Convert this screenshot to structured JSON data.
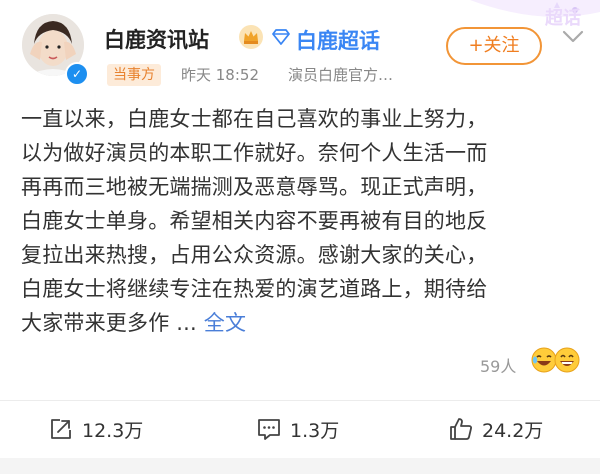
{
  "header": {
    "username": "白鹿资讯站",
    "topic_link": "白鹿超话",
    "follow_label": "+关注",
    "badge": "当事方",
    "time": "昨天 18:52",
    "source": "演员白鹿官方…"
  },
  "post": {
    "lines": [
      "一直以来，白鹿女士都在自己喜欢的事业上努力，",
      "以为做好演员的本职工作就好。奈何个人生活一而",
      "再再而三地被无端揣测及恶意辱骂。现正式声明，",
      "白鹿女士单身。希望相关内容不要再被有目的地反",
      "复拉出来热搜，占用公众资源。感谢大家的关心，",
      "白鹿女士将继续专注在热爱的演艺道路上，期待给"
    ],
    "last_line": "大家带来更多作 ...",
    "more_label": "全文"
  },
  "reactions": {
    "count_label": "59人"
  },
  "actions": {
    "repost": "12.3万",
    "comment": "1.3万",
    "like": "24.2万"
  },
  "colors": {
    "accent_orange": "#f07e20",
    "link_blue": "#3a86f4",
    "verified_blue": "#1d8ff0"
  }
}
